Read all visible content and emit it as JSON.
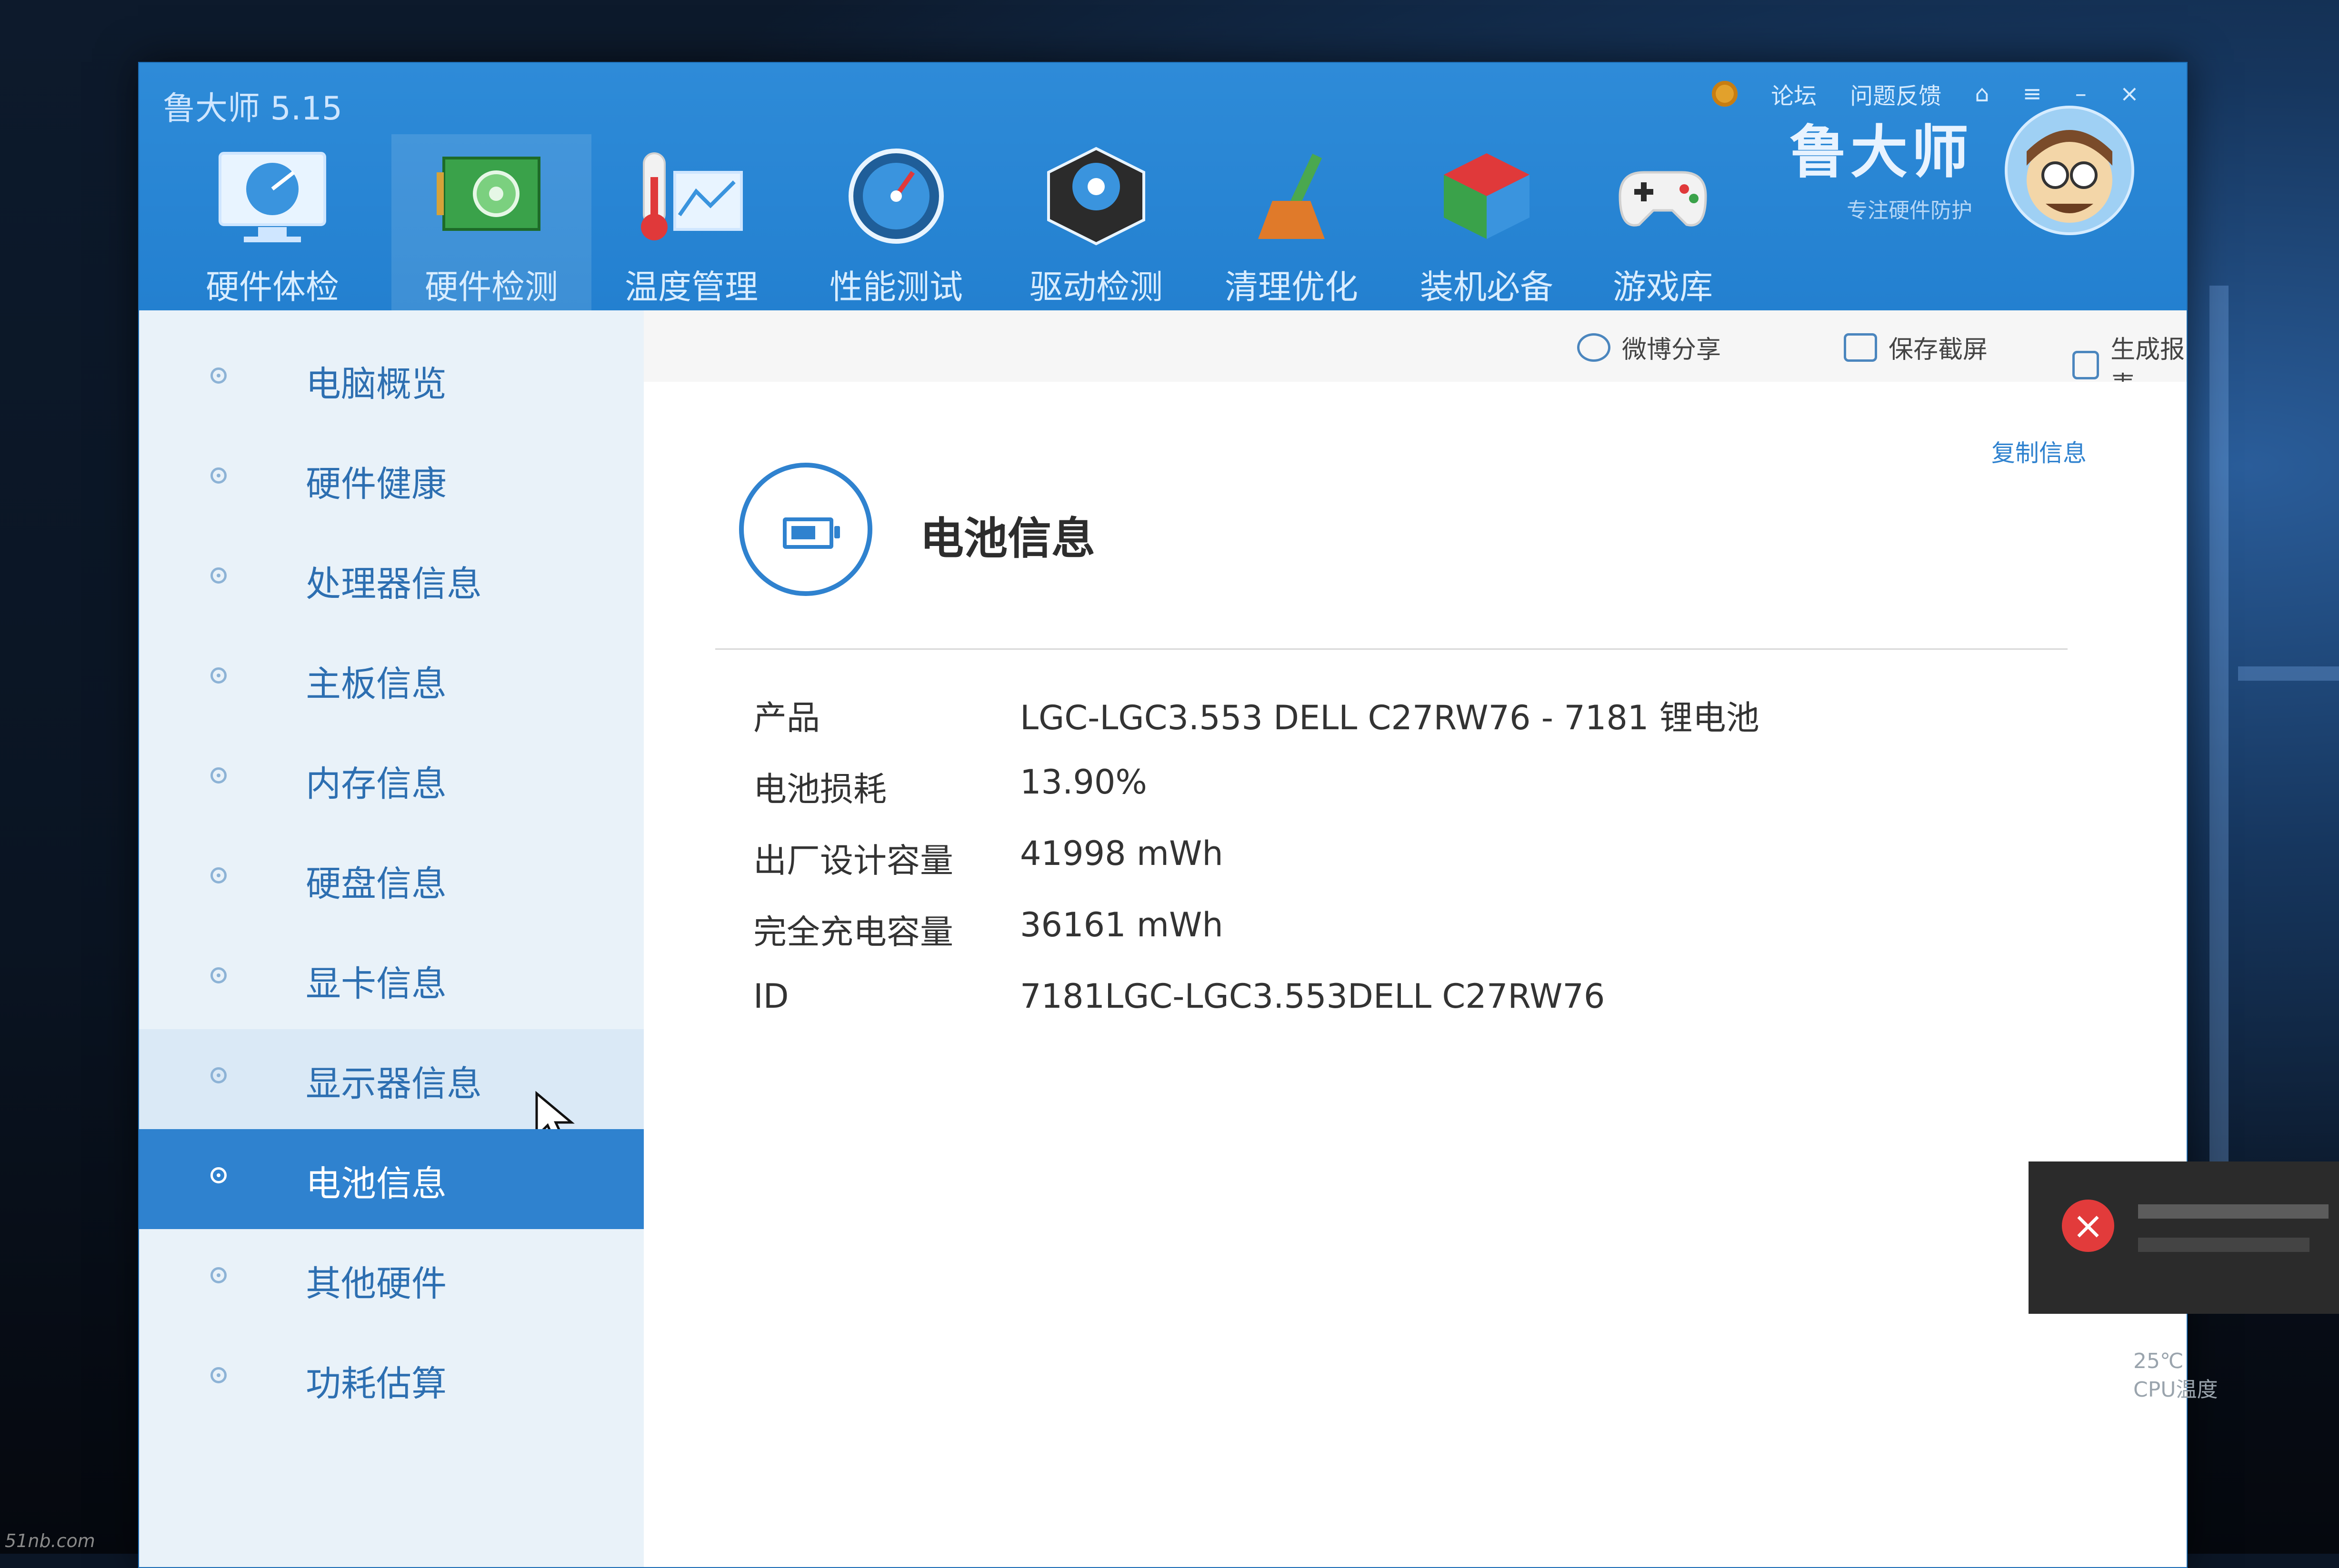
{
  "app": {
    "title": "鲁大师 5.15",
    "brand_name": "鲁大师",
    "brand_subtitle": "专注硬件防护",
    "window_controls": {
      "forum": "论坛",
      "feedback": "问题反馈",
      "skin": "⌂",
      "menu": "≡",
      "minimize": "–",
      "close": "×"
    }
  },
  "tabs": [
    {
      "label": "硬件体检",
      "icon": "monitor-check-icon"
    },
    {
      "label": "硬件检测",
      "icon": "circuit-board-icon",
      "active": true
    },
    {
      "label": "温度管理",
      "icon": "thermometer-icon"
    },
    {
      "label": "性能测试",
      "icon": "speedometer-icon"
    },
    {
      "label": "驱动检测",
      "icon": "gear-box-icon"
    },
    {
      "label": "清理优化",
      "icon": "broom-icon"
    },
    {
      "label": "装机必备",
      "icon": "cube-icon"
    },
    {
      "label": "游戏库",
      "icon": "gamepad-icon"
    }
  ],
  "toolbar": {
    "weibo_share": "微博分享",
    "save_screenshot": "保存截屏",
    "generate_report": "生成报表"
  },
  "sidebar": {
    "items": [
      {
        "label": "电脑概览"
      },
      {
        "label": "硬件健康"
      },
      {
        "label": "处理器信息"
      },
      {
        "label": "主板信息"
      },
      {
        "label": "内存信息"
      },
      {
        "label": "硬盘信息"
      },
      {
        "label": "显卡信息"
      },
      {
        "label": "显示器信息",
        "hover": true
      },
      {
        "label": "电池信息",
        "active": true
      },
      {
        "label": "其他硬件"
      },
      {
        "label": "功耗估算"
      }
    ]
  },
  "content": {
    "copy_info": "复制信息",
    "section_title": "电池信息",
    "rows": [
      {
        "key": "产品",
        "value": "LGC-LGC3.553 DELL C27RW76 - 7181 锂电池"
      },
      {
        "key": "电池损耗",
        "value": "13.90%"
      },
      {
        "key": "出厂设计容量",
        "value": "41998 mWh"
      },
      {
        "key": "完全充电容量",
        "value": "36161 mWh"
      },
      {
        "key": "ID",
        "value": "7181LGC-LGC3.553DELL C27RW76"
      }
    ]
  },
  "taskbar": {
    "temperature": "25℃",
    "cpu_label": "CPU温度"
  },
  "watermark": "51nb.com",
  "colors": {
    "accent": "#2f82cf",
    "titlebar": "#2380d0",
    "sidebar_bg": "#e9f2f9"
  }
}
